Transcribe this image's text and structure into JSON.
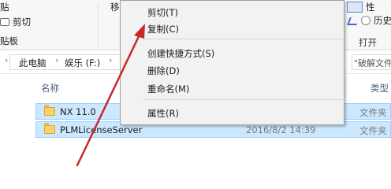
{
  "ribbon": {
    "paste_partial": "贴",
    "cut": "剪切",
    "paste_shortcut_partial": "贴板",
    "move_partial": "移",
    "properties_partial": "性",
    "history": "历史记",
    "open_group": "打开"
  },
  "address": {
    "root": "此电脑",
    "drive": "娱乐 (F:)",
    "search_partial": "\"破解文件"
  },
  "columns": {
    "name": "名称",
    "type_partial": "类型"
  },
  "files": [
    {
      "name": "NX 11.0",
      "date": "",
      "type": "文件夹"
    },
    {
      "name": "PLMLicenseServer",
      "date": "2016/8/2 14:39",
      "type": "文件夹"
    }
  ],
  "context_menu": {
    "cut": "剪切(T)",
    "copy": "复制(C)",
    "create_shortcut": "创建快捷方式(S)",
    "delete": "删除(D)",
    "rename": "重命名(M)",
    "properties": "属性(R)"
  },
  "colors": {
    "annotation_arrow": "#c62828",
    "selection_fill": "#cce8ff",
    "selection_border": "#99d1ff",
    "folder": "#f7d36a"
  }
}
